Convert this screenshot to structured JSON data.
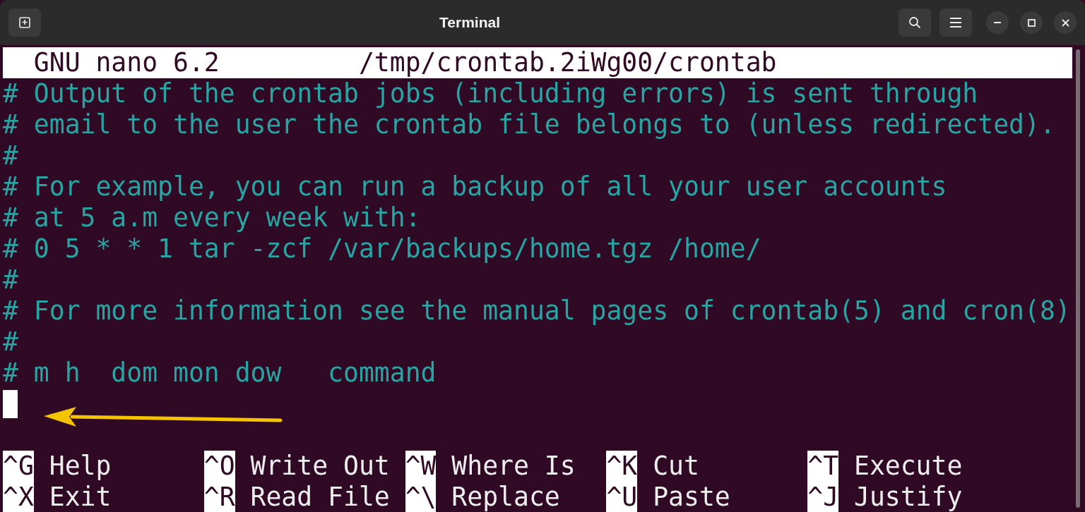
{
  "window": {
    "title": "Terminal"
  },
  "editor_header": {
    "app": "GNU nano 6.2",
    "file": "/tmp/crontab.2iWg00/crontab"
  },
  "lines": [
    "# Output of the crontab jobs (including errors) is sent through",
    "# email to the user the crontab file belongs to (unless redirected).",
    "#",
    "# For example, you can run a backup of all your user accounts",
    "# at 5 a.m every week with:",
    "# 0 5 * * 1 tar -zcf /var/backups/home.tgz /home/",
    "#",
    "# For more information see the manual pages of crontab(5) and cron(8)",
    "#",
    "# m h  dom mon dow   command"
  ],
  "shortcuts": [
    {
      "key": "^G",
      "label": "Help"
    },
    {
      "key": "^O",
      "label": "Write Out"
    },
    {
      "key": "^W",
      "label": "Where Is"
    },
    {
      "key": "^K",
      "label": "Cut"
    },
    {
      "key": "^T",
      "label": "Execute"
    },
    {
      "key": "^X",
      "label": "Exit"
    },
    {
      "key": "^R",
      "label": "Read File"
    },
    {
      "key": "^\\",
      "label": "Replace"
    },
    {
      "key": "^U",
      "label": "Paste"
    },
    {
      "key": "^J",
      "label": "Justify"
    }
  ]
}
